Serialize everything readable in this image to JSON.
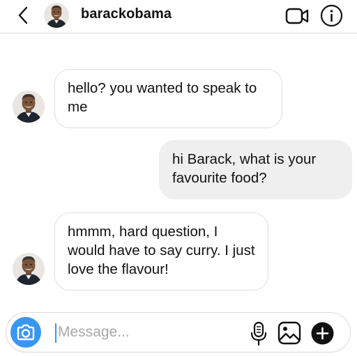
{
  "header": {
    "username": "barackobama"
  },
  "messages": [
    {
      "direction": "incoming",
      "text": "hello? you wanted to speak to me"
    },
    {
      "direction": "outgoing",
      "text": "hi Barack, what is your favourite food?"
    },
    {
      "direction": "incoming",
      "text": "hmmm, hard question, I would have to say curry. I just love the flavour!"
    }
  ],
  "composer": {
    "placeholder": "Message..."
  },
  "colors": {
    "accent": "#3897f0",
    "bubble_out": "#efefef",
    "border": "#dedede"
  },
  "icons": {
    "back": "chevron-left-icon",
    "video": "video-camera-icon",
    "info": "info-icon",
    "camera": "camera-icon",
    "mic": "microphone-icon",
    "gallery": "image-gallery-icon",
    "add": "plus-icon"
  }
}
